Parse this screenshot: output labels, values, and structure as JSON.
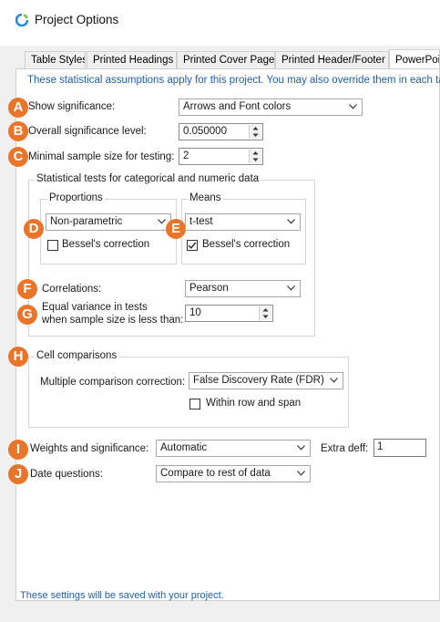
{
  "window": {
    "title": "Project Options"
  },
  "tabs": [
    {
      "label": "Table Styles"
    },
    {
      "label": "Printed Headings"
    },
    {
      "label": "Printed Cover Page"
    },
    {
      "label": "Printed Header/Footer"
    },
    {
      "label": "PowerPoi"
    }
  ],
  "info_text": "These statistical assumptions apply for this project.  You may also override them in each tal",
  "show_significance": {
    "label": "Show significance:",
    "value": "Arrows and Font colors"
  },
  "overall_significance": {
    "label": "Overall significance level:",
    "value": "0.050000"
  },
  "minimal_sample": {
    "label": "Minimal sample size for testing:",
    "value": "2"
  },
  "stat_tests_group": {
    "label": "Statistical tests for categorical and numeric data",
    "proportions": {
      "label": "Proportions",
      "value": "Non-parametric",
      "bessel_label": "Bessel's correction",
      "bessel_checked": false
    },
    "means": {
      "label": "Means",
      "value": "t-test",
      "bessel_label": "Bessel's correction",
      "bessel_checked": true
    },
    "correlations": {
      "label": "Correlations:",
      "value": "Pearson"
    },
    "equal_variance": {
      "label_line1": "Equal variance in tests",
      "label_line2": "when sample size is less than:",
      "value": "10"
    }
  },
  "cell_comparisons": {
    "label": "Cell comparisons",
    "multiple_label": "Multiple comparison correction:",
    "multiple_value": "False Discovery Rate (FDR)",
    "within_label": "Within row and span",
    "within_checked": false
  },
  "weights": {
    "label": "Weights and significance:",
    "value": "Automatic",
    "extra_label": "Extra deff:",
    "extra_value": "1"
  },
  "date_questions": {
    "label": "Date questions:",
    "value": "Compare to rest of data"
  },
  "footer_text": "These settings will be saved with your project.",
  "badges": [
    "A",
    "B",
    "C",
    "D",
    "E",
    "F",
    "G",
    "H",
    "I",
    "J"
  ],
  "colors": {
    "badge": "#e8752a",
    "info_text": "#1f5fa8"
  }
}
